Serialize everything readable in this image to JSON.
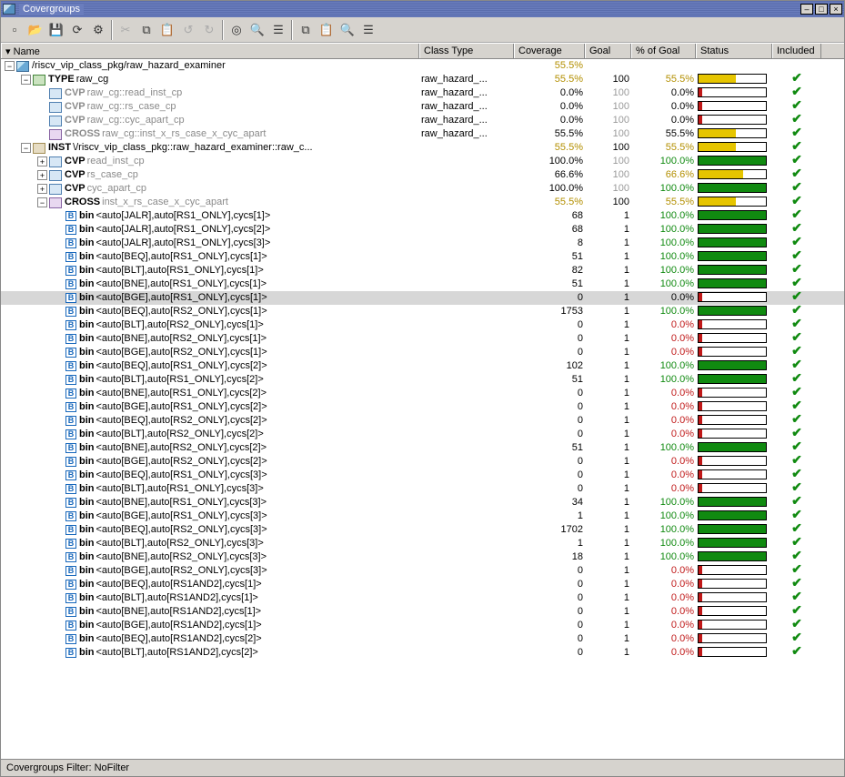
{
  "window": {
    "title": "Covergroups"
  },
  "columns": {
    "name": "Name",
    "classType": "Class Type",
    "coverage": "Coverage",
    "goal": "Goal",
    "pctOfGoal": "% of Goal",
    "status": "Status",
    "included": "Included"
  },
  "footer": "Covergroups Filter: NoFilter",
  "toolbar_icons": [
    "new",
    "open",
    "save",
    "refresh",
    "cfg",
    "sep",
    "cut",
    "copy",
    "paste",
    "undo",
    "redo",
    "sep",
    "mark",
    "find",
    "tree",
    "sep",
    "copy2",
    "paste2",
    "find2",
    "tree2"
  ],
  "rows": [
    {
      "indent": 0,
      "exp": "-",
      "icon": "pkg",
      "kw": "",
      "label": "/riscv_vip_class_pkg/raw_hazard_examiner",
      "classType": "",
      "coverage": "55.5%",
      "covCls": "cov-yellow",
      "goal": "",
      "goalCls": "",
      "pct": "",
      "pctCls": "",
      "bar": null,
      "inc": false
    },
    {
      "indent": 1,
      "exp": "-",
      "icon": "type",
      "kw": "TYPE",
      "label": "raw_cg",
      "classType": "raw_hazard_...",
      "coverage": "55.5%",
      "covCls": "cov-yellow",
      "goal": "100",
      "goalCls": "",
      "pct": "55.5%",
      "pctCls": "cov-yellow",
      "bar": {
        "type": "yellow",
        "pct": 55
      },
      "inc": true
    },
    {
      "indent": 2,
      "exp": "",
      "icon": "cvp",
      "kw": "CVP",
      "kgray": true,
      "label": "raw_cg::read_inst_cp",
      "gray": true,
      "classType": "raw_hazard_...",
      "coverage": "0.0%",
      "covCls": "",
      "goal": "100",
      "goalCls": "goal-gray",
      "pct": "0.0%",
      "pctCls": "",
      "bar": {
        "type": "red",
        "pct": 0
      },
      "inc": true
    },
    {
      "indent": 2,
      "exp": "",
      "icon": "cvp",
      "kw": "CVP",
      "kgray": true,
      "label": "raw_cg::rs_case_cp",
      "gray": true,
      "classType": "raw_hazard_...",
      "coverage": "0.0%",
      "covCls": "",
      "goal": "100",
      "goalCls": "goal-gray",
      "pct": "0.0%",
      "pctCls": "",
      "bar": {
        "type": "red",
        "pct": 0
      },
      "inc": true
    },
    {
      "indent": 2,
      "exp": "",
      "icon": "cvp",
      "kw": "CVP",
      "kgray": true,
      "label": "raw_cg::cyc_apart_cp",
      "gray": true,
      "classType": "raw_hazard_...",
      "coverage": "0.0%",
      "covCls": "",
      "goal": "100",
      "goalCls": "goal-gray",
      "pct": "0.0%",
      "pctCls": "",
      "bar": {
        "type": "red",
        "pct": 0
      },
      "inc": true
    },
    {
      "indent": 2,
      "exp": "",
      "icon": "cross",
      "kw": "CROSS",
      "kgray": true,
      "label": "raw_cg::inst_x_rs_case_x_cyc_apart",
      "gray": true,
      "classType": "raw_hazard_...",
      "coverage": "55.5%",
      "covCls": "",
      "goal": "100",
      "goalCls": "goal-gray",
      "pct": "55.5%",
      "pctCls": "",
      "bar": {
        "type": "yellow",
        "pct": 55
      },
      "inc": true
    },
    {
      "indent": 1,
      "exp": "-",
      "icon": "inst",
      "kw": "INST",
      "label": "\\/riscv_vip_class_pkg::raw_hazard_examiner::raw_c...",
      "classType": "",
      "coverage": "55.5%",
      "covCls": "cov-yellow",
      "goal": "100",
      "goalCls": "",
      "pct": "55.5%",
      "pctCls": "cov-yellow",
      "bar": {
        "type": "yellow",
        "pct": 55
      },
      "inc": true
    },
    {
      "indent": 2,
      "exp": "+",
      "icon": "cvp",
      "kw": "CVP",
      "label": "read_inst_cp",
      "gray": true,
      "classType": "",
      "coverage": "100.0%",
      "covCls": "",
      "goal": "100",
      "goalCls": "goal-gray",
      "pct": "100.0%",
      "pctCls": "cov-green",
      "bar": {
        "type": "green",
        "pct": 100
      },
      "inc": true
    },
    {
      "indent": 2,
      "exp": "+",
      "icon": "cvp",
      "kw": "CVP",
      "label": "rs_case_cp",
      "gray": true,
      "classType": "",
      "coverage": "66.6%",
      "covCls": "",
      "goal": "100",
      "goalCls": "goal-gray",
      "pct": "66.6%",
      "pctCls": "cov-yellow",
      "bar": {
        "type": "yellow",
        "pct": 66
      },
      "inc": true
    },
    {
      "indent": 2,
      "exp": "+",
      "icon": "cvp",
      "kw": "CVP",
      "label": "cyc_apart_cp",
      "gray": true,
      "classType": "",
      "coverage": "100.0%",
      "covCls": "",
      "goal": "100",
      "goalCls": "goal-gray",
      "pct": "100.0%",
      "pctCls": "cov-green",
      "bar": {
        "type": "green",
        "pct": 100
      },
      "inc": true
    },
    {
      "indent": 2,
      "exp": "-",
      "icon": "cross",
      "kw": "CROSS",
      "label": "inst_x_rs_case_x_cyc_apart",
      "gray": true,
      "classType": "",
      "coverage": "55.5%",
      "covCls": "cov-yellow",
      "goal": "100",
      "goalCls": "",
      "pct": "55.5%",
      "pctCls": "cov-yellow",
      "bar": {
        "type": "yellow",
        "pct": 55
      },
      "inc": true
    },
    {
      "indent": 3,
      "exp": "",
      "icon": "bin",
      "kw": "bin",
      "label": "<auto[JALR],auto[RS1_ONLY],cycs[1]>",
      "classType": "",
      "coverage": "68",
      "covCls": "",
      "goal": "1",
      "goalCls": "",
      "pct": "100.0%",
      "pctCls": "cov-green",
      "bar": {
        "type": "green",
        "pct": 100
      },
      "inc": true
    },
    {
      "indent": 3,
      "exp": "",
      "icon": "bin",
      "kw": "bin",
      "label": "<auto[JALR],auto[RS1_ONLY],cycs[2]>",
      "classType": "",
      "coverage": "68",
      "covCls": "",
      "goal": "1",
      "goalCls": "",
      "pct": "100.0%",
      "pctCls": "cov-green",
      "bar": {
        "type": "green",
        "pct": 100
      },
      "inc": true
    },
    {
      "indent": 3,
      "exp": "",
      "icon": "bin",
      "kw": "bin",
      "label": "<auto[JALR],auto[RS1_ONLY],cycs[3]>",
      "classType": "",
      "coverage": "8",
      "covCls": "",
      "goal": "1",
      "goalCls": "",
      "pct": "100.0%",
      "pctCls": "cov-green",
      "bar": {
        "type": "green",
        "pct": 100
      },
      "inc": true
    },
    {
      "indent": 3,
      "exp": "",
      "icon": "bin",
      "kw": "bin",
      "label": "<auto[BEQ],auto[RS1_ONLY],cycs[1]>",
      "classType": "",
      "coverage": "51",
      "covCls": "",
      "goal": "1",
      "goalCls": "",
      "pct": "100.0%",
      "pctCls": "cov-green",
      "bar": {
        "type": "green",
        "pct": 100
      },
      "inc": true
    },
    {
      "indent": 3,
      "exp": "",
      "icon": "bin",
      "kw": "bin",
      "label": "<auto[BLT],auto[RS1_ONLY],cycs[1]>",
      "classType": "",
      "coverage": "82",
      "covCls": "",
      "goal": "1",
      "goalCls": "",
      "pct": "100.0%",
      "pctCls": "cov-green",
      "bar": {
        "type": "green",
        "pct": 100
      },
      "inc": true
    },
    {
      "indent": 3,
      "exp": "",
      "icon": "bin",
      "kw": "bin",
      "label": "<auto[BNE],auto[RS1_ONLY],cycs[1]>",
      "classType": "",
      "coverage": "51",
      "covCls": "",
      "goal": "1",
      "goalCls": "",
      "pct": "100.0%",
      "pctCls": "cov-green",
      "bar": {
        "type": "green",
        "pct": 100
      },
      "inc": true
    },
    {
      "indent": 3,
      "exp": "",
      "icon": "bin",
      "kw": "bin",
      "label": "<auto[BGE],auto[RS1_ONLY],cycs[1]>",
      "classType": "",
      "coverage": "0",
      "covCls": "",
      "goal": "1",
      "goalCls": "",
      "pct": "0.0%",
      "pctCls": "",
      "bar": {
        "type": "red",
        "pct": 0
      },
      "inc": true,
      "selected": true
    },
    {
      "indent": 3,
      "exp": "",
      "icon": "bin",
      "kw": "bin",
      "label": "<auto[BEQ],auto[RS2_ONLY],cycs[1]>",
      "classType": "",
      "coverage": "1753",
      "covCls": "",
      "goal": "1",
      "goalCls": "",
      "pct": "100.0%",
      "pctCls": "cov-green",
      "bar": {
        "type": "green",
        "pct": 100
      },
      "inc": true
    },
    {
      "indent": 3,
      "exp": "",
      "icon": "bin",
      "kw": "bin",
      "label": "<auto[BLT],auto[RS2_ONLY],cycs[1]>",
      "classType": "",
      "coverage": "0",
      "covCls": "",
      "goal": "1",
      "goalCls": "",
      "pct": "0.0%",
      "pctCls": "cov-red",
      "bar": {
        "type": "red",
        "pct": 0
      },
      "inc": true
    },
    {
      "indent": 3,
      "exp": "",
      "icon": "bin",
      "kw": "bin",
      "label": "<auto[BNE],auto[RS2_ONLY],cycs[1]>",
      "classType": "",
      "coverage": "0",
      "covCls": "",
      "goal": "1",
      "goalCls": "",
      "pct": "0.0%",
      "pctCls": "cov-red",
      "bar": {
        "type": "red",
        "pct": 0
      },
      "inc": true
    },
    {
      "indent": 3,
      "exp": "",
      "icon": "bin",
      "kw": "bin",
      "label": "<auto[BGE],auto[RS2_ONLY],cycs[1]>",
      "classType": "",
      "coverage": "0",
      "covCls": "",
      "goal": "1",
      "goalCls": "",
      "pct": "0.0%",
      "pctCls": "cov-red",
      "bar": {
        "type": "red",
        "pct": 0
      },
      "inc": true
    },
    {
      "indent": 3,
      "exp": "",
      "icon": "bin",
      "kw": "bin",
      "label": "<auto[BEQ],auto[RS1_ONLY],cycs[2]>",
      "classType": "",
      "coverage": "102",
      "covCls": "",
      "goal": "1",
      "goalCls": "",
      "pct": "100.0%",
      "pctCls": "cov-green",
      "bar": {
        "type": "green",
        "pct": 100
      },
      "inc": true
    },
    {
      "indent": 3,
      "exp": "",
      "icon": "bin",
      "kw": "bin",
      "label": "<auto[BLT],auto[RS1_ONLY],cycs[2]>",
      "classType": "",
      "coverage": "51",
      "covCls": "",
      "goal": "1",
      "goalCls": "",
      "pct": "100.0%",
      "pctCls": "cov-green",
      "bar": {
        "type": "green",
        "pct": 100
      },
      "inc": true
    },
    {
      "indent": 3,
      "exp": "",
      "icon": "bin",
      "kw": "bin",
      "label": "<auto[BNE],auto[RS1_ONLY],cycs[2]>",
      "classType": "",
      "coverage": "0",
      "covCls": "",
      "goal": "1",
      "goalCls": "",
      "pct": "0.0%",
      "pctCls": "cov-red",
      "bar": {
        "type": "red",
        "pct": 0
      },
      "inc": true
    },
    {
      "indent": 3,
      "exp": "",
      "icon": "bin",
      "kw": "bin",
      "label": "<auto[BGE],auto[RS1_ONLY],cycs[2]>",
      "classType": "",
      "coverage": "0",
      "covCls": "",
      "goal": "1",
      "goalCls": "",
      "pct": "0.0%",
      "pctCls": "cov-red",
      "bar": {
        "type": "red",
        "pct": 0
      },
      "inc": true
    },
    {
      "indent": 3,
      "exp": "",
      "icon": "bin",
      "kw": "bin",
      "label": "<auto[BEQ],auto[RS2_ONLY],cycs[2]>",
      "classType": "",
      "coverage": "0",
      "covCls": "",
      "goal": "1",
      "goalCls": "",
      "pct": "0.0%",
      "pctCls": "cov-red",
      "bar": {
        "type": "red",
        "pct": 0
      },
      "inc": true
    },
    {
      "indent": 3,
      "exp": "",
      "icon": "bin",
      "kw": "bin",
      "label": "<auto[BLT],auto[RS2_ONLY],cycs[2]>",
      "classType": "",
      "coverage": "0",
      "covCls": "",
      "goal": "1",
      "goalCls": "",
      "pct": "0.0%",
      "pctCls": "cov-red",
      "bar": {
        "type": "red",
        "pct": 0
      },
      "inc": true
    },
    {
      "indent": 3,
      "exp": "",
      "icon": "bin",
      "kw": "bin",
      "label": "<auto[BNE],auto[RS2_ONLY],cycs[2]>",
      "classType": "",
      "coverage": "51",
      "covCls": "",
      "goal": "1",
      "goalCls": "",
      "pct": "100.0%",
      "pctCls": "cov-green",
      "bar": {
        "type": "green",
        "pct": 100
      },
      "inc": true
    },
    {
      "indent": 3,
      "exp": "",
      "icon": "bin",
      "kw": "bin",
      "label": "<auto[BGE],auto[RS2_ONLY],cycs[2]>",
      "classType": "",
      "coverage": "0",
      "covCls": "",
      "goal": "1",
      "goalCls": "",
      "pct": "0.0%",
      "pctCls": "cov-red",
      "bar": {
        "type": "red",
        "pct": 0
      },
      "inc": true
    },
    {
      "indent": 3,
      "exp": "",
      "icon": "bin",
      "kw": "bin",
      "label": "<auto[BEQ],auto[RS1_ONLY],cycs[3]>",
      "classType": "",
      "coverage": "0",
      "covCls": "",
      "goal": "1",
      "goalCls": "",
      "pct": "0.0%",
      "pctCls": "cov-red",
      "bar": {
        "type": "red",
        "pct": 0
      },
      "inc": true
    },
    {
      "indent": 3,
      "exp": "",
      "icon": "bin",
      "kw": "bin",
      "label": "<auto[BLT],auto[RS1_ONLY],cycs[3]>",
      "classType": "",
      "coverage": "0",
      "covCls": "",
      "goal": "1",
      "goalCls": "",
      "pct": "0.0%",
      "pctCls": "cov-red",
      "bar": {
        "type": "red",
        "pct": 0
      },
      "inc": true
    },
    {
      "indent": 3,
      "exp": "",
      "icon": "bin",
      "kw": "bin",
      "label": "<auto[BNE],auto[RS1_ONLY],cycs[3]>",
      "classType": "",
      "coverage": "34",
      "covCls": "",
      "goal": "1",
      "goalCls": "",
      "pct": "100.0%",
      "pctCls": "cov-green",
      "bar": {
        "type": "green",
        "pct": 100
      },
      "inc": true
    },
    {
      "indent": 3,
      "exp": "",
      "icon": "bin",
      "kw": "bin",
      "label": "<auto[BGE],auto[RS1_ONLY],cycs[3]>",
      "classType": "",
      "coverage": "1",
      "covCls": "",
      "goal": "1",
      "goalCls": "",
      "pct": "100.0%",
      "pctCls": "cov-green",
      "bar": {
        "type": "green",
        "pct": 100
      },
      "inc": true
    },
    {
      "indent": 3,
      "exp": "",
      "icon": "bin",
      "kw": "bin",
      "label": "<auto[BEQ],auto[RS2_ONLY],cycs[3]>",
      "classType": "",
      "coverage": "1702",
      "covCls": "",
      "goal": "1",
      "goalCls": "",
      "pct": "100.0%",
      "pctCls": "cov-green",
      "bar": {
        "type": "green",
        "pct": 100
      },
      "inc": true
    },
    {
      "indent": 3,
      "exp": "",
      "icon": "bin",
      "kw": "bin",
      "label": "<auto[BLT],auto[RS2_ONLY],cycs[3]>",
      "classType": "",
      "coverage": "1",
      "covCls": "",
      "goal": "1",
      "goalCls": "",
      "pct": "100.0%",
      "pctCls": "cov-green",
      "bar": {
        "type": "green",
        "pct": 100
      },
      "inc": true
    },
    {
      "indent": 3,
      "exp": "",
      "icon": "bin",
      "kw": "bin",
      "label": "<auto[BNE],auto[RS2_ONLY],cycs[3]>",
      "classType": "",
      "coverage": "18",
      "covCls": "",
      "goal": "1",
      "goalCls": "",
      "pct": "100.0%",
      "pctCls": "cov-green",
      "bar": {
        "type": "green",
        "pct": 100
      },
      "inc": true
    },
    {
      "indent": 3,
      "exp": "",
      "icon": "bin",
      "kw": "bin",
      "label": "<auto[BGE],auto[RS2_ONLY],cycs[3]>",
      "classType": "",
      "coverage": "0",
      "covCls": "",
      "goal": "1",
      "goalCls": "",
      "pct": "0.0%",
      "pctCls": "cov-red",
      "bar": {
        "type": "red",
        "pct": 0
      },
      "inc": true
    },
    {
      "indent": 3,
      "exp": "",
      "icon": "bin",
      "kw": "bin",
      "label": "<auto[BEQ],auto[RS1AND2],cycs[1]>",
      "classType": "",
      "coverage": "0",
      "covCls": "",
      "goal": "1",
      "goalCls": "",
      "pct": "0.0%",
      "pctCls": "cov-red",
      "bar": {
        "type": "red",
        "pct": 0
      },
      "inc": true
    },
    {
      "indent": 3,
      "exp": "",
      "icon": "bin",
      "kw": "bin",
      "label": "<auto[BLT],auto[RS1AND2],cycs[1]>",
      "classType": "",
      "coverage": "0",
      "covCls": "",
      "goal": "1",
      "goalCls": "",
      "pct": "0.0%",
      "pctCls": "cov-red",
      "bar": {
        "type": "red",
        "pct": 0
      },
      "inc": true
    },
    {
      "indent": 3,
      "exp": "",
      "icon": "bin",
      "kw": "bin",
      "label": "<auto[BNE],auto[RS1AND2],cycs[1]>",
      "classType": "",
      "coverage": "0",
      "covCls": "",
      "goal": "1",
      "goalCls": "",
      "pct": "0.0%",
      "pctCls": "cov-red",
      "bar": {
        "type": "red",
        "pct": 0
      },
      "inc": true
    },
    {
      "indent": 3,
      "exp": "",
      "icon": "bin",
      "kw": "bin",
      "label": "<auto[BGE],auto[RS1AND2],cycs[1]>",
      "classType": "",
      "coverage": "0",
      "covCls": "",
      "goal": "1",
      "goalCls": "",
      "pct": "0.0%",
      "pctCls": "cov-red",
      "bar": {
        "type": "red",
        "pct": 0
      },
      "inc": true
    },
    {
      "indent": 3,
      "exp": "",
      "icon": "bin",
      "kw": "bin",
      "label": "<auto[BEQ],auto[RS1AND2],cycs[2]>",
      "classType": "",
      "coverage": "0",
      "covCls": "",
      "goal": "1",
      "goalCls": "",
      "pct": "0.0%",
      "pctCls": "cov-red",
      "bar": {
        "type": "red",
        "pct": 0
      },
      "inc": true
    },
    {
      "indent": 3,
      "exp": "",
      "icon": "bin",
      "kw": "bin",
      "label": "<auto[BLT],auto[RS1AND2],cycs[2]>",
      "classType": "",
      "coverage": "0",
      "covCls": "",
      "goal": "1",
      "goalCls": "",
      "pct": "0.0%",
      "pctCls": "cov-red",
      "bar": {
        "type": "red",
        "pct": 0
      },
      "inc": true
    }
  ]
}
